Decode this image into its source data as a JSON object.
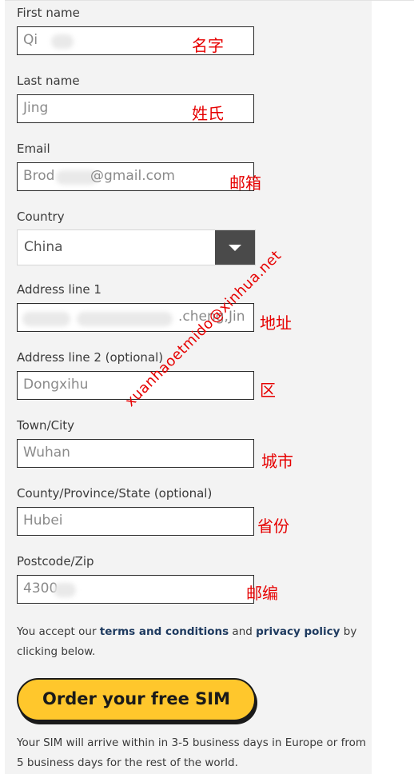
{
  "form": {
    "first_name": {
      "label": "First name",
      "value": "Qi",
      "note": "名字"
    },
    "last_name": {
      "label": "Last name",
      "value": "Jing",
      "note": "姓氏"
    },
    "email": {
      "label": "Email",
      "value_prefix": "Brod",
      "value_suffix": "@gmail.com",
      "note": "邮箱"
    },
    "country": {
      "label": "Country",
      "value": "China"
    },
    "address1": {
      "label": "Address line 1",
      "value": ".cheng,Jin",
      "note": "地址"
    },
    "address2": {
      "label": "Address line 2 (optional)",
      "value": "Dongxihu",
      "note": "区"
    },
    "town": {
      "label": "Town/City",
      "value": "Wuhan",
      "note": "城市"
    },
    "county": {
      "label": "County/Province/State (optional)",
      "value": "Hubei",
      "note": "省份"
    },
    "postcode": {
      "label": "Postcode/Zip",
      "value": "4300",
      "note": "邮编"
    }
  },
  "terms": {
    "prefix": "You accept our ",
    "terms_link": "terms and conditions",
    "middle": " and ",
    "privacy_link": "privacy policy",
    "suffix": " by clicking below."
  },
  "cta_label": "Order your free SIM",
  "shipping_note": "Your SIM will arrive within in 3-5 business days in Europe or from 5 business days for the rest of the world.",
  "watermark": "xuanhaoetmido@xinhua.net"
}
